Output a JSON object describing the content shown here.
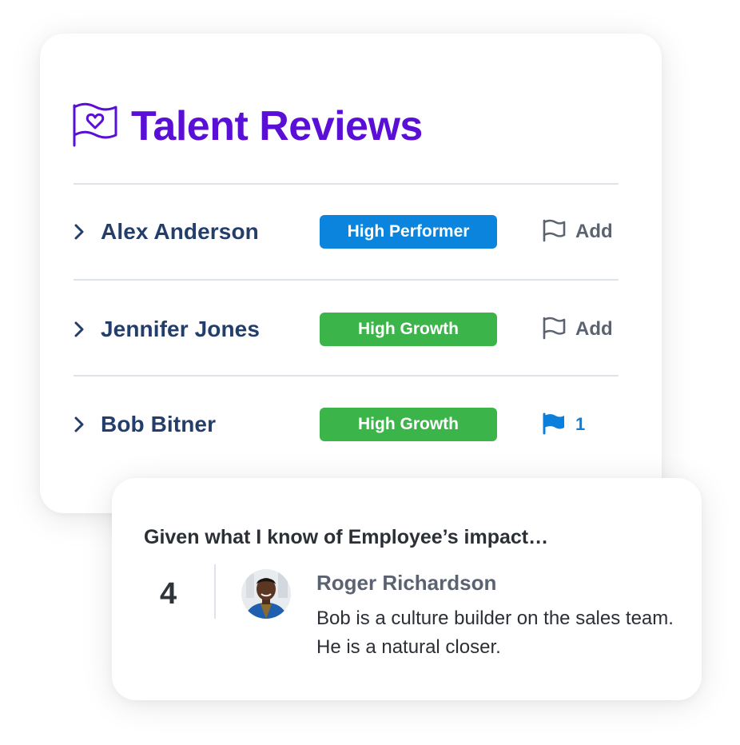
{
  "header": {
    "title": "Talent Reviews",
    "icon": "flag-heart-icon",
    "accent_color": "#5a0fd6"
  },
  "reviews": [
    {
      "name": "Alex Anderson",
      "badge": "High Performer",
      "badge_color": "#0a84dc",
      "action": {
        "type": "add",
        "icon": "flag-outline-icon",
        "label": "Add"
      }
    },
    {
      "name": "Jennifer Jones",
      "badge": "High Growth",
      "badge_color": "#3bb54a",
      "action": {
        "type": "add",
        "icon": "flag-outline-icon",
        "label": "Add"
      }
    },
    {
      "name": "Bob Bitner",
      "badge": "High Growth",
      "badge_color": "#3bb54a",
      "action": {
        "type": "count",
        "icon": "flag-filled-icon",
        "label": "1"
      }
    }
  ],
  "comment_card": {
    "question": "Given what I know of Employee’s impact…",
    "score": "4",
    "reviewer": {
      "name": "Roger Richardson",
      "avatar": "avatar-photo"
    },
    "comment": "Bob is a culture builder on the sales team. He is a natural closer."
  }
}
